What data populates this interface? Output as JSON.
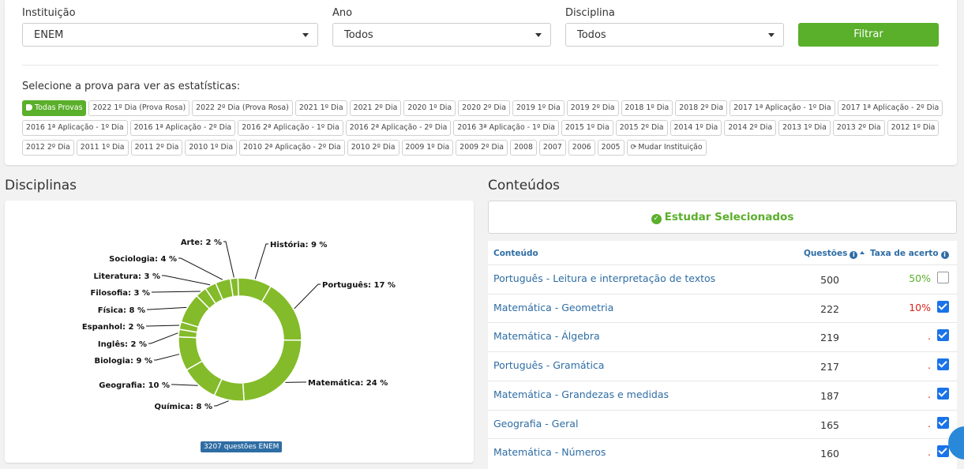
{
  "filters": {
    "institution": {
      "label": "Instituição",
      "value": "ENEM"
    },
    "year": {
      "label": "Ano",
      "value": "Todos"
    },
    "discipline": {
      "label": "Disciplina",
      "value": "Todos"
    },
    "filter_button": "Filtrar"
  },
  "exam_select_label": "Selecione a prova para ver as estatísticas:",
  "exam_chips": [
    "Todas Provas",
    "2022 1º Dia (Prova Rosa)",
    "2022 2º Dia (Prova Rosa)",
    "2021 1º Dia",
    "2021 2º Dia",
    "2020 1º Dia",
    "2020 2º Dia",
    "2019 1º Dia",
    "2019 2º Dia",
    "2018 1º Dia",
    "2018 2º Dia",
    "2017 1ª Aplicação - 1º Dia",
    "2017 1ª Aplicação - 2º Dia",
    "2016 1ª Aplicação - 1º Dia",
    "2016 1ª Aplicação - 2º Dia",
    "2016 2ª Aplicação - 1º Dia",
    "2016 2ª Aplicação - 2º Dia",
    "2016 3ª Aplicação - 1º Dia",
    "2015 1º Dia",
    "2015 2º Dia",
    "2014 1º Dia",
    "2014 2º Dia",
    "2013 1º Dia",
    "2013 2º Dia",
    "2012 1º Dia",
    "2012 2º Dia",
    "2011 1º Dia",
    "2011 2º Dia",
    "2010 1º Dia",
    "2010 2ª Aplicação - 2º Dia",
    "2010 2º Dia",
    "2009 1º Dia",
    "2009 2º Dia",
    "2008",
    "2007",
    "2006",
    "2005",
    "Mudar Instituição"
  ],
  "disciplinas": {
    "heading": "Disciplinas",
    "badge": "3207 questões ENEM"
  },
  "chart_data": {
    "type": "pie",
    "variant": "donut",
    "color": "#84bb2a",
    "slices": [
      {
        "label": "História",
        "value": 9
      },
      {
        "label": "Português",
        "value": 17
      },
      {
        "label": "Matemática",
        "value": 24
      },
      {
        "label": "Química",
        "value": 8
      },
      {
        "label": "Geografia",
        "value": 10
      },
      {
        "label": "Biologia",
        "value": 9
      },
      {
        "label": "Inglês",
        "value": 2
      },
      {
        "label": "Espanhol",
        "value": 2
      },
      {
        "label": "Física",
        "value": 8
      },
      {
        "label": "Filosofia",
        "value": 3
      },
      {
        "label": "Literatura",
        "value": 3
      },
      {
        "label": "Sociologia",
        "value": 4
      },
      {
        "label": "Arte",
        "value": 2
      }
    ],
    "label_suffix": " %"
  },
  "conteudos": {
    "heading": "Conteúdos",
    "study_button": "Estudar Selecionados",
    "columns": {
      "content": "Conteúdo",
      "questions": "Questões",
      "rate": "Taxa de acerto"
    },
    "rows": [
      {
        "subject": "Português",
        "topic": "Leitura e interpretação de textos",
        "count": "500",
        "rate": "50%",
        "rate_color": "#5aaf2b",
        "checked": false
      },
      {
        "subject": "Matemática",
        "topic": "Geometria",
        "count": "222",
        "rate": "10%",
        "rate_color": "#d9241c",
        "checked": true
      },
      {
        "subject": "Matemática",
        "topic": "Álgebra",
        "count": "219",
        "rate": ".",
        "rate_color": "#d9241c",
        "checked": true
      },
      {
        "subject": "Português",
        "topic": "Gramática",
        "count": "217",
        "rate": ".",
        "rate_color": "#d9241c",
        "checked": true
      },
      {
        "subject": "Matemática",
        "topic": "Grandezas e medidas",
        "count": "187",
        "rate": ".",
        "rate_color": "#d9241c",
        "checked": true
      },
      {
        "subject": "Geografia",
        "topic": "Geral",
        "count": "165",
        "rate": ".",
        "rate_color": "#d9241c",
        "checked": true
      },
      {
        "subject": "Matemática",
        "topic": "Números",
        "count": "160",
        "rate": ".",
        "rate_color": "#d9241c",
        "checked": true
      }
    ]
  }
}
